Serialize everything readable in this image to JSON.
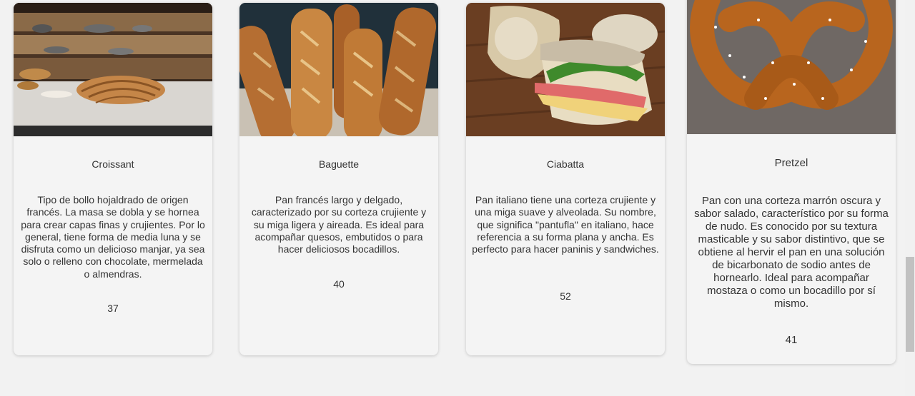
{
  "products": [
    {
      "name": "Croissant",
      "description": "Tipo de bollo hojaldrado de origen francés. La masa se dobla y se hornea para crear capas finas y crujientes. Por lo general, tiene forma de media luna y se disfruta como un delicioso manjar, ya sea solo o relleno con chocolate, mermelada o almendras.",
      "price": "37",
      "image": "croissant-photo"
    },
    {
      "name": "Baguette",
      "description": "Pan francés largo y delgado, caracterizado por su corteza crujiente y su miga ligera y aireada. Es ideal para acompañar quesos, embutidos o para hacer deliciosos bocadillos.",
      "price": "40",
      "image": "baguette-photo"
    },
    {
      "name": "Ciabatta",
      "description": "Pan italiano tiene una corteza crujiente y una miga suave y alveolada. Su nombre, que significa \"pantufla\" en italiano, hace referencia a su forma plana y ancha. Es perfecto para hacer paninis y sandwiches.",
      "price": "52",
      "image": "ciabatta-photo"
    },
    {
      "name": "Pretzel",
      "description": "Pan con una corteza marrón oscura y sabor salado, característico por su forma de nudo. Es conocido por su textura masticable y su sabor distintivo, que se obtiene al hervir el pan en una solución de bicarbonato de sodio antes de hornearlo. Ideal para acompañar mostaza o como un bocadillo por sí mismo.",
      "price": "41",
      "image": "pretzel-photo"
    }
  ]
}
